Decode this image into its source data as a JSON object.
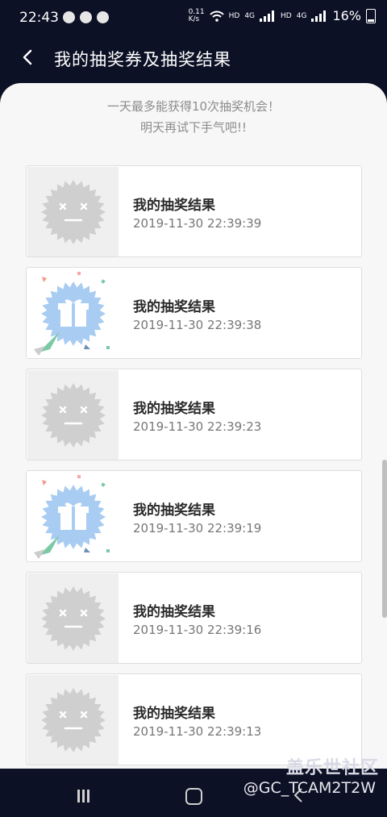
{
  "status_bar": {
    "time": "22:43",
    "net_speed_top": "0.11",
    "net_speed_bottom": "K/s",
    "hd1": "HD",
    "g1": "4G",
    "hd2": "HD",
    "g2": "4G",
    "battery": "16%"
  },
  "header": {
    "title": "我的抽奖券及抽奖结果"
  },
  "notice": {
    "line1": "一天最多能获得10次抽奖机会！",
    "line2": "明天再试下手气吧!!"
  },
  "results": [
    {
      "type": "lose",
      "title": "我的抽奖结果",
      "time": "2019-11-30 22:39:39"
    },
    {
      "type": "win",
      "title": "我的抽奖结果",
      "time": "2019-11-30 22:39:38"
    },
    {
      "type": "lose",
      "title": "我的抽奖结果",
      "time": "2019-11-30 22:39:23"
    },
    {
      "type": "win",
      "title": "我的抽奖结果",
      "time": "2019-11-30 22:39:19"
    },
    {
      "type": "lose",
      "title": "我的抽奖结果",
      "time": "2019-11-30 22:39:16"
    },
    {
      "type": "lose",
      "title": "我的抽奖结果",
      "time": "2019-11-30 22:39:13"
    }
  ],
  "watermark": {
    "brand": "盖乐世社区",
    "handle": "@GC_TCAM2T2W"
  },
  "colors": {
    "background": "#0d1126",
    "sheet": "#f7f7f7",
    "win_badge": "#a9ccf2",
    "lose_badge": "#cfcfcf"
  }
}
